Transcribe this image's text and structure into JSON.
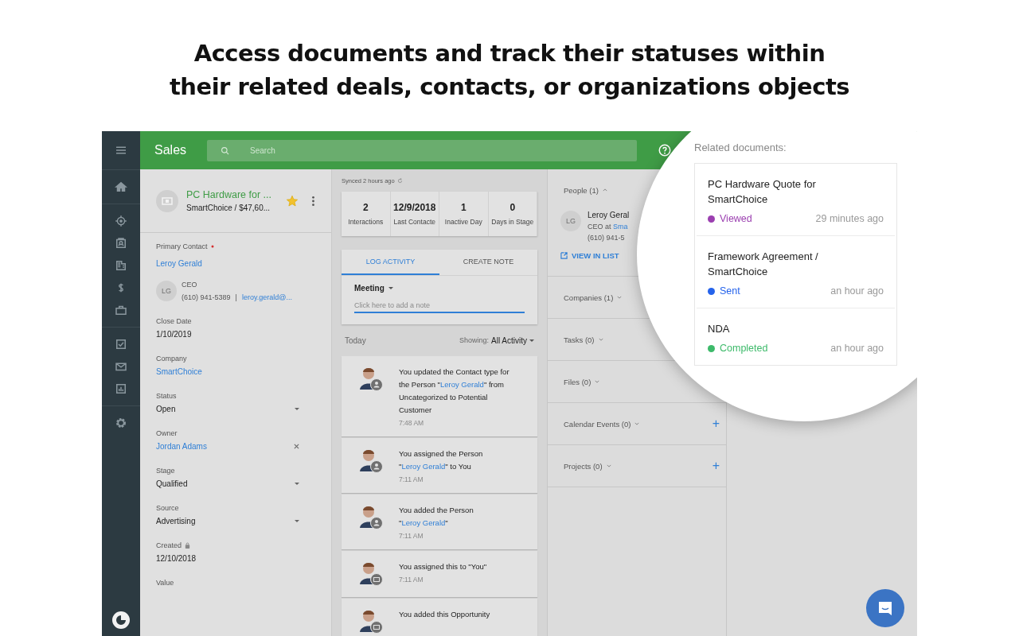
{
  "headline": [
    "Access documents and track their statuses within",
    "their related deals, contacts, or organizations objects"
  ],
  "app": {
    "title": "Sales",
    "search": {
      "placeholder": "Search"
    }
  },
  "nav_groups": [
    [
      {
        "kind": "home"
      }
    ],
    [
      {
        "kind": "target"
      },
      {
        "kind": "contacts"
      },
      {
        "kind": "building"
      },
      {
        "kind": "dollar"
      },
      {
        "kind": "briefcase"
      }
    ],
    [
      {
        "kind": "check"
      },
      {
        "kind": "mail"
      },
      {
        "kind": "chart"
      }
    ],
    [
      {
        "kind": "gear"
      }
    ]
  ],
  "deal": {
    "title": "PC Hardware for ...",
    "subtitle": "SmartChoice / $47,60...",
    "starred": true
  },
  "fields": [
    {
      "label": "Primary Contact",
      "required": true,
      "kind": "contact",
      "value": "Leroy Gerald",
      "contact": {
        "initials": "LG",
        "role": "CEO",
        "phone": "(610) 941-5389",
        "separator": "|",
        "email": "leroy.gerald@..."
      }
    },
    {
      "label": "Close Date",
      "kind": "text",
      "value": "1/10/2019"
    },
    {
      "label": "Company",
      "kind": "link",
      "value": "SmartChoice"
    },
    {
      "label": "Status",
      "kind": "select",
      "value": "Open"
    },
    {
      "label": "Owner",
      "kind": "clearable",
      "value": "Jordan Adams"
    },
    {
      "label": "Stage",
      "kind": "select",
      "value": "Qualified"
    },
    {
      "label": "Source",
      "kind": "select",
      "value": "Advertising"
    },
    {
      "label": "Created",
      "kind": "text",
      "locked": true,
      "value": "12/10/2018"
    },
    {
      "label": "Value"
    }
  ],
  "synced": "Synced 2 hours ago",
  "stats": [
    {
      "value": "2",
      "label": "Interactions"
    },
    {
      "value": "12/9/2018",
      "label": "Last Contacte"
    },
    {
      "value": "1",
      "label": "Inactive Day"
    },
    {
      "value": "0",
      "label": "Days in Stage"
    }
  ],
  "tabs": [
    {
      "label": "LOG ACTIVITY",
      "selected": true
    },
    {
      "label": "CREATE NOTE",
      "selected": false
    }
  ],
  "activity_type": "Meeting",
  "note": {
    "placeholder": "Click here to add a note"
  },
  "feed_header": {
    "day": "Today",
    "showing": "Showing:",
    "filter": "All Activity"
  },
  "feed": [
    {
      "kind": "person",
      "parts": [
        {
          "text": "You updated the Contact type for the Person \""
        },
        {
          "text": "Leroy Gerald",
          "link": true
        },
        {
          "text": "\" from Uncategorized to Potential Customer"
        }
      ],
      "time": "7:48 AM"
    },
    {
      "kind": "person",
      "parts": [
        {
          "text": "You assigned the Person \""
        },
        {
          "text": "Leroy Gerald",
          "link": true
        },
        {
          "text": "\" to You"
        }
      ],
      "time": "7:11 AM"
    },
    {
      "kind": "person",
      "parts": [
        {
          "text": "You added the Person \""
        },
        {
          "text": "Leroy Gerald",
          "link": true
        },
        {
          "text": "\""
        }
      ],
      "time": "7:11 AM"
    },
    {
      "kind": "deal",
      "parts": [
        {
          "text": "You assigned this to \"You\""
        }
      ],
      "time": "7:11 AM"
    },
    {
      "kind": "deal",
      "parts": [
        {
          "text": "You added this Opportunity"
        }
      ]
    }
  ],
  "related": [
    {
      "label": "People (1)",
      "expanded": true,
      "addable": false,
      "person": {
        "initials": "LG",
        "name": "Leroy Geral",
        "role": "CEO at ",
        "company": "Sma",
        "phone": "(610) 941-5"
      },
      "action": "VIEW IN LIST"
    },
    {
      "label": "Companies (1)",
      "expanded": false,
      "addable": false
    },
    {
      "label": "Tasks (0)",
      "expanded": false,
      "addable": false
    },
    {
      "label": "Files (0)",
      "expanded": false,
      "addable": false
    },
    {
      "label": "Calendar Events (0)",
      "expanded": false,
      "addable": true,
      "add": "+"
    },
    {
      "label": "Projects (0)",
      "expanded": false,
      "addable": true,
      "add": "+"
    }
  ],
  "related_documents": {
    "title": "Related documents:",
    "items": [
      {
        "name": "PC Hardware Quote for SmartChoice",
        "status": "Viewed",
        "color": "#9b3fb0",
        "time": "29 minutes ago"
      },
      {
        "name": "Framework Agreement / SmartChoice",
        "status": "Sent",
        "color": "#2563eb",
        "time": "an hour ago"
      },
      {
        "name": "NDA",
        "status": "Completed",
        "color": "#3dba6a",
        "time": "an hour ago"
      }
    ]
  }
}
